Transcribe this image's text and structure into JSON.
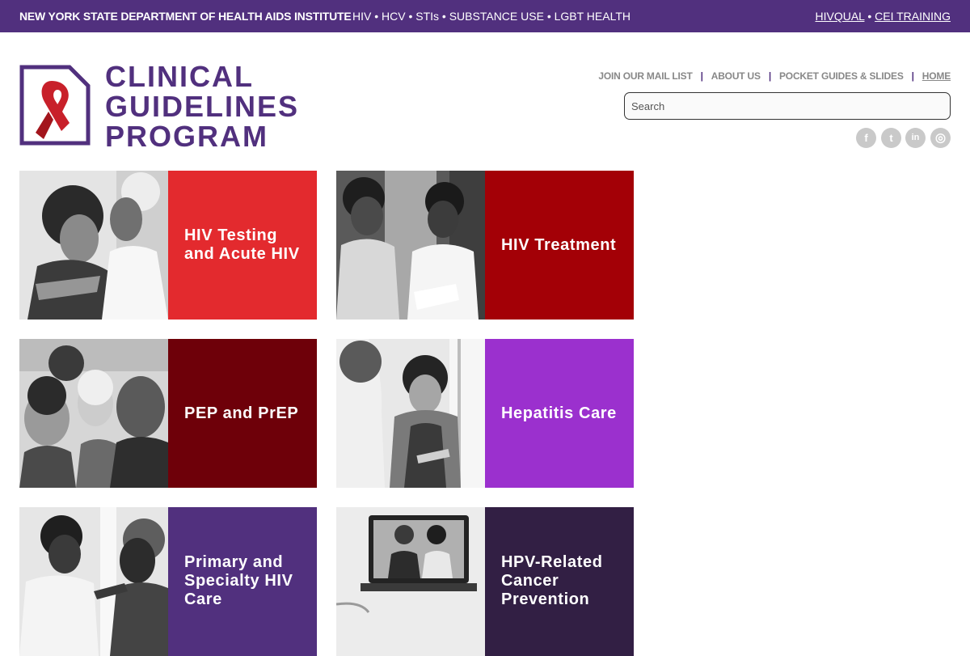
{
  "topbar": {
    "org": "NEW YORK STATE DEPARTMENT OF HEALTH AIDS INSTITUTE",
    "topics": "HIV • HCV • STIs • SUBSTANCE USE • LGBT HEALTH",
    "link1": "HIVQUAL",
    "separator": " • ",
    "link2": "CEI TRAINING"
  },
  "logo": {
    "line1": "CLINICAL",
    "line2": "GUIDELINES",
    "line3": "PROGRAM",
    "icon": "red-ribbon-icon",
    "color": "#51307e",
    "ribbon_color": "#c8202a"
  },
  "nav": {
    "items": [
      "JOIN OUR MAIL LIST",
      "ABOUT US",
      "POCKET GUIDES & SLIDES",
      "HOME"
    ],
    "separator": "|"
  },
  "search": {
    "placeholder": "Search"
  },
  "social": [
    {
      "icon": "facebook-icon",
      "glyph": "f"
    },
    {
      "icon": "twitter-icon",
      "glyph": "t"
    },
    {
      "icon": "linkedin-icon",
      "glyph": "in"
    },
    {
      "icon": "instagram-icon",
      "glyph": "◎"
    }
  ],
  "tiles": [
    {
      "label": "HIV Testing and Acute HIV",
      "color": "#e32a2e"
    },
    {
      "label": "HIV Treatment",
      "color": "#a30006"
    },
    {
      "label": "PEP and PrEP",
      "color": "#6e0009"
    },
    {
      "label": "Hepatitis Care",
      "color": "#9b30ce"
    },
    {
      "label": "Primary and Specialty HIV Care",
      "color": "#51307e"
    },
    {
      "label": "HPV-Related Cancer Prevention",
      "color": "#321f44"
    }
  ]
}
